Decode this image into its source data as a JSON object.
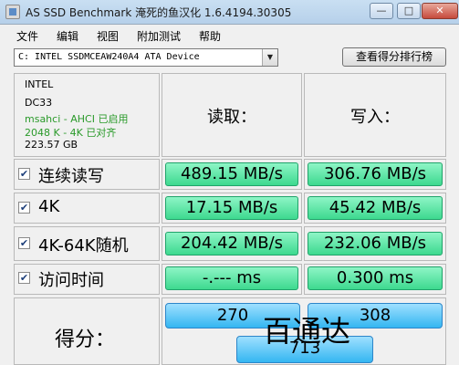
{
  "window": {
    "title": "AS SSD Benchmark 淹死的鱼汉化 1.6.4194.30305",
    "minimize_label": "—",
    "maximize_label": "□",
    "close_label": "✕"
  },
  "menu": [
    "文件",
    "编辑",
    "视图",
    "附加测试",
    "帮助"
  ],
  "device": {
    "selected": "C: INTEL SSDMCEAW240A4 ATA Device",
    "rank_button": "查看得分排行榜"
  },
  "drive_info": {
    "vendor": "INTEL",
    "firmware": "DC33",
    "driver": "msahci - AHCI 已启用",
    "alignment": "2048 K - 4K 已对齐",
    "capacity": "223.57 GB",
    "ok_color": "#2a9a2a"
  },
  "columns": {
    "read": "读取：",
    "write": "写入："
  },
  "rows": [
    {
      "label": "连续读写",
      "checked": true,
      "read": "489.15 MB/s",
      "write": "306.76 MB/s"
    },
    {
      "label": "4K",
      "checked": true,
      "read": "17.15 MB/s",
      "write": "45.42 MB/s"
    },
    {
      "label": "4K-64K随机",
      "checked": true,
      "read": "204.42 MB/s",
      "write": "232.06 MB/s"
    },
    {
      "label": "访问时间",
      "checked": true,
      "read": "-.--- ms",
      "write": "0.300 ms"
    }
  ],
  "score": {
    "label": "得分：",
    "read": "270",
    "write": "308",
    "total": "713"
  },
  "watermark": "百通达",
  "colors": {
    "result_green": "#3dd98f",
    "score_blue": "#34b6f1",
    "title_bar": "#b6d0ea"
  }
}
